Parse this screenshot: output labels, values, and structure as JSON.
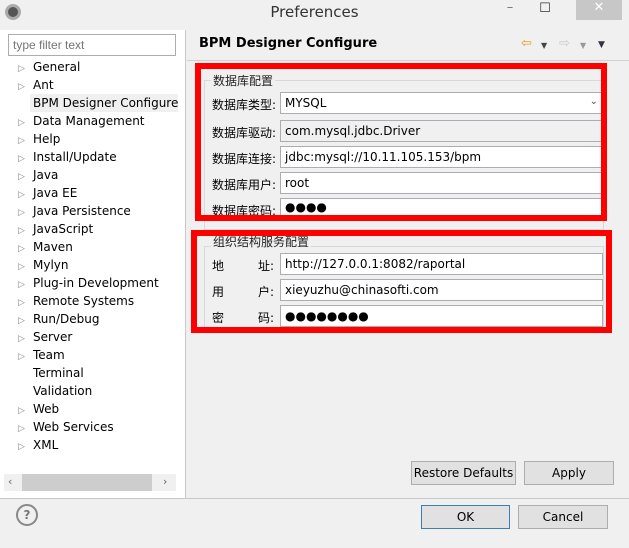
{
  "window": {
    "title": "Preferences",
    "minimize": "–",
    "maximize": "☐",
    "close": "✕"
  },
  "filter": {
    "placeholder": "type filter text"
  },
  "tree": [
    {
      "label": "General",
      "expandable": true
    },
    {
      "label": "Ant",
      "expandable": true
    },
    {
      "label": "BPM Designer Configure",
      "expandable": false,
      "selected": true
    },
    {
      "label": "Data Management",
      "expandable": true
    },
    {
      "label": "Help",
      "expandable": true
    },
    {
      "label": "Install/Update",
      "expandable": true
    },
    {
      "label": "Java",
      "expandable": true
    },
    {
      "label": "Java EE",
      "expandable": true
    },
    {
      "label": "Java Persistence",
      "expandable": true
    },
    {
      "label": "JavaScript",
      "expandable": true
    },
    {
      "label": "Maven",
      "expandable": true
    },
    {
      "label": "Mylyn",
      "expandable": true
    },
    {
      "label": "Plug-in Development",
      "expandable": true
    },
    {
      "label": "Remote Systems",
      "expandable": true
    },
    {
      "label": "Run/Debug",
      "expandable": true
    },
    {
      "label": "Server",
      "expandable": true
    },
    {
      "label": "Team",
      "expandable": true
    },
    {
      "label": "Terminal",
      "expandable": false
    },
    {
      "label": "Validation",
      "expandable": false
    },
    {
      "label": "Web",
      "expandable": true
    },
    {
      "label": "Web Services",
      "expandable": true
    },
    {
      "label": "XML",
      "expandable": true
    }
  ],
  "page": {
    "title": "BPM Designer Configure"
  },
  "db": {
    "legend": "数据库配置",
    "type_label": "数据库类型:",
    "type_value": "MYSQL",
    "driver_label": "数据库驱动:",
    "driver_value": "com.mysql.jdbc.Driver",
    "url_label": "数据库连接:",
    "url_value": "jdbc:mysql://10.11.105.153/bpm",
    "user_label": "数据库用户:",
    "user_value": "root",
    "pwd_label": "数据库密码:",
    "pwd_value": "●●●●"
  },
  "org": {
    "legend": "组织结构服务配置",
    "addr_label_a": "地",
    "addr_label_b": "址:",
    "addr_value": "http://127.0.0.1:8082/raportal",
    "user_label_a": "用",
    "user_label_b": "户:",
    "user_value": "xieyuzhu@chinasofti.com",
    "pwd_label_a": "密",
    "pwd_label_b": "码:",
    "pwd_value": "●●●●●●●●"
  },
  "buttons": {
    "restore": "Restore Defaults",
    "apply": "Apply",
    "ok": "OK",
    "cancel": "Cancel"
  },
  "colors": {
    "highlight_box": "#ff0000",
    "ok_border": "#3c7fb1"
  }
}
